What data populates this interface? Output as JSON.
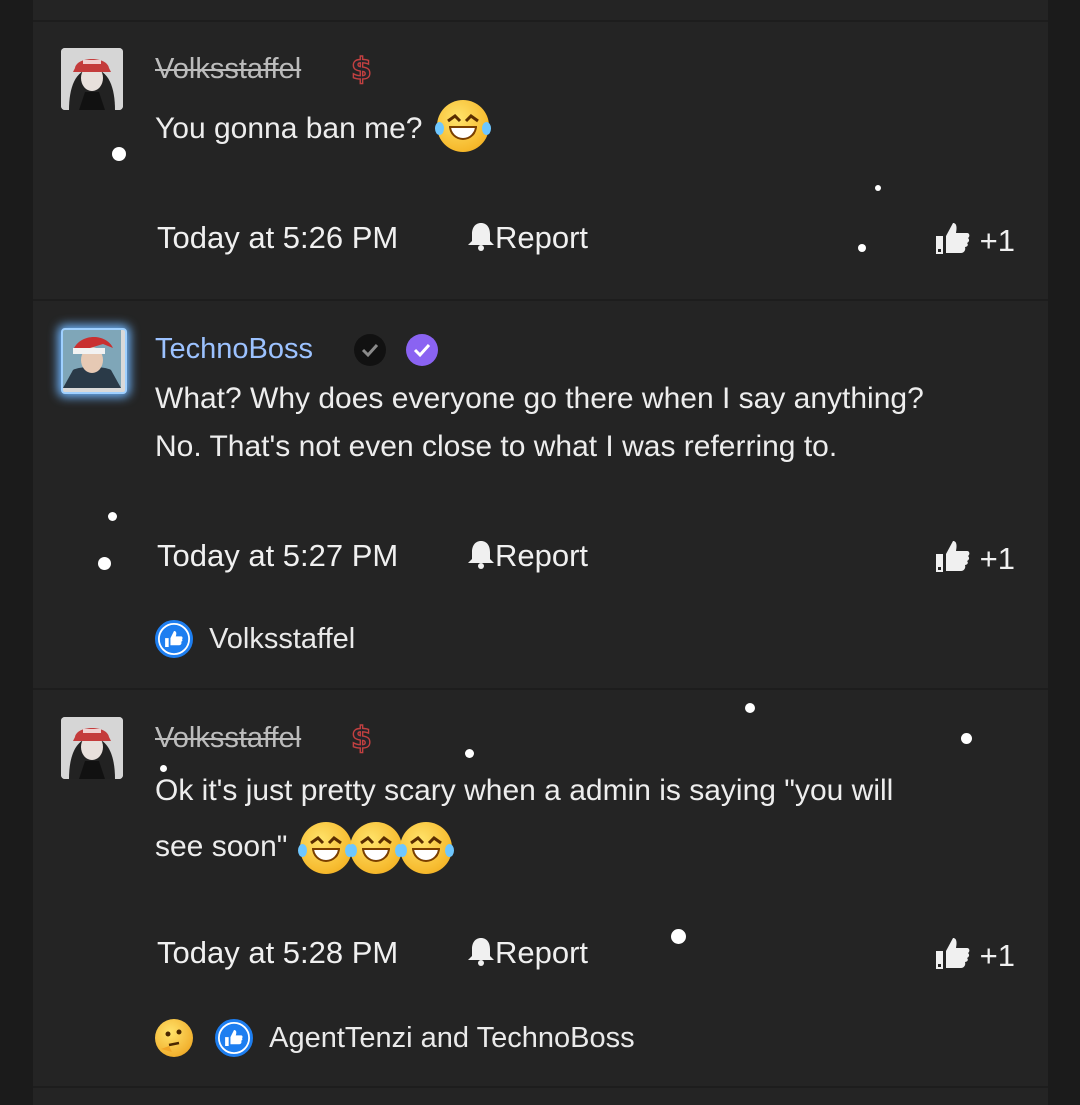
{
  "comments": [
    {
      "username": "Volksstaffel",
      "text_lines": [
        "You gonna ban me?"
      ],
      "timestamp": "Today at 5:26 PM",
      "report_label": "Report",
      "like_count": "+1"
    },
    {
      "username": "TechnoBoss",
      "text_lines": [
        "What? Why does everyone go there when I say anything?",
        "No. That's not even close to what I was referring to."
      ],
      "timestamp": "Today at 5:27 PM",
      "report_label": "Report",
      "like_count": "+1",
      "reactions_text": "Volksstaffel"
    },
    {
      "username": "Volksstaffel",
      "text_lines": [
        "Ok it's just pretty scary when a admin is saying \"you will",
        "see soon\""
      ],
      "timestamp": "Today at 5:28 PM",
      "report_label": "Report",
      "like_count": "+1",
      "reactions_text": "AgentTenzi and TechnoBoss"
    }
  ],
  "icons": {
    "dollar": "$",
    "bell": "bell-icon",
    "thumb": "thumbs-up-icon",
    "badge_black": "check-badge-icon",
    "badge_purple": "verified-badge-icon"
  },
  "colors": {
    "background": "#242424",
    "username_strike": "#bcbcbc",
    "username_tech": "#9cc2ff",
    "like_blue": "#1d7ef0",
    "verified_purple": "#8a63f2"
  }
}
